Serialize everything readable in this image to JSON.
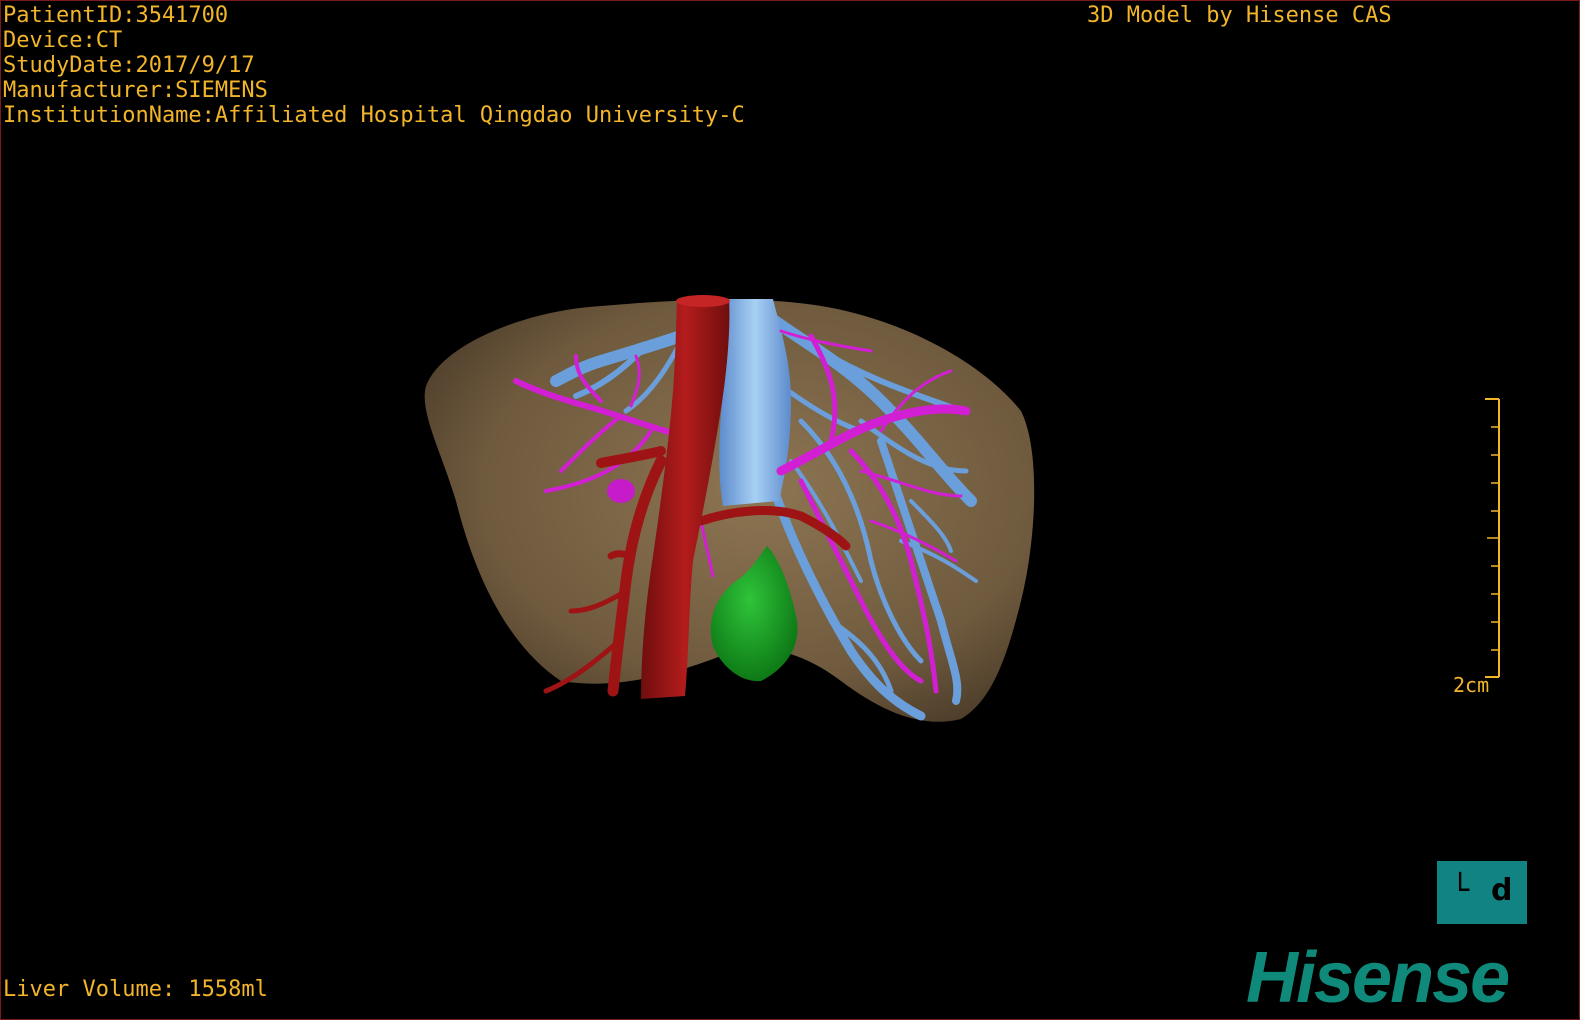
{
  "overlay": {
    "patient_id": "PatientID:3541700",
    "device": "Device:CT",
    "study_date": "StudyDate:2017/9/17",
    "manufacturer": "Manufacturer:SIEMENS",
    "institution": "InstitutionName:Affiliated Hospital Qingdao University-C",
    "credit": "3D Model by Hisense CAS",
    "liver_volume": "Liver Volume: 1558ml",
    "scale_label": "2cm"
  },
  "orientation": {
    "left": "└",
    "right": "d",
    "icon": "orientation-cube-icon"
  },
  "brand": {
    "logo_text": "Hisense",
    "logo_color": "#0f8a7a"
  },
  "colors": {
    "text": "#f2b52a",
    "liver": "#7a6446",
    "artery": "#9e1414",
    "portal_vein": "#d21fd4",
    "hepatic_vein": "#6b9fdc",
    "gallbladder": "#18a323"
  }
}
